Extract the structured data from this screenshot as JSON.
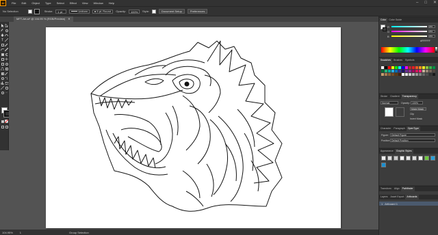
{
  "app": {
    "logo": "Ai",
    "menu": [
      "File",
      "Edit",
      "Object",
      "Type",
      "Select",
      "Effect",
      "View",
      "Window",
      "Help"
    ],
    "window_controls": [
      "–",
      "□",
      "✕"
    ]
  },
  "control_bar": {
    "selection": "No Selection",
    "stroke_label": "Stroke:",
    "stroke_value": "1 pt",
    "profile": "Uniform",
    "brush": "5 pt. Round",
    "opacity_label": "Opacity:",
    "opacity_value": "100%",
    "style_label": "Style:",
    "doc_setup": "Document Setup",
    "preferences": "Preferences"
  },
  "document_tab": {
    "title": "MFT-Art.ai* @ 104.95 % (RGB/Preview)",
    "close": "✕"
  },
  "status_bar": {
    "zoom": "104.95%",
    "artboard": "1",
    "tool": "Group Selection"
  },
  "panels": {
    "color": {
      "tabs": [
        "Color",
        "Color Guide"
      ],
      "hex": "FFFFFF",
      "sliders": [
        {
          "label": "R",
          "value": "255"
        },
        {
          "label": "G",
          "value": "255"
        },
        {
          "label": "B",
          "value": "255"
        }
      ]
    },
    "swatches": {
      "tabs": [
        "Swatches",
        "Brushes",
        "Symbols"
      ]
    },
    "transparency": {
      "tabs": [
        "Stroke",
        "Gradient",
        "Transparency"
      ],
      "mode": "Normal",
      "opacity_label": "Opacity:",
      "opacity_value": "100%",
      "make_mask": "Make Mask",
      "clip": "Clip",
      "invert": "Invert Mask"
    },
    "opentype": {
      "tabs": [
        "Character",
        "Paragraph",
        "OpenType"
      ],
      "figure_label": "Figure:",
      "figure_value": "Default Figure",
      "position_label": "Position:",
      "position_value": "Default Position"
    },
    "graphic_styles": {
      "tabs": [
        "Appearance",
        "Graphic Styles"
      ]
    },
    "artboards": {
      "tabs": [
        "Transform",
        "Align",
        "Pathfinder"
      ],
      "tabs2": [
        "Layers",
        "Asset Export",
        "Artboards"
      ],
      "item": "Artboard 1",
      "item_num": "1"
    }
  }
}
